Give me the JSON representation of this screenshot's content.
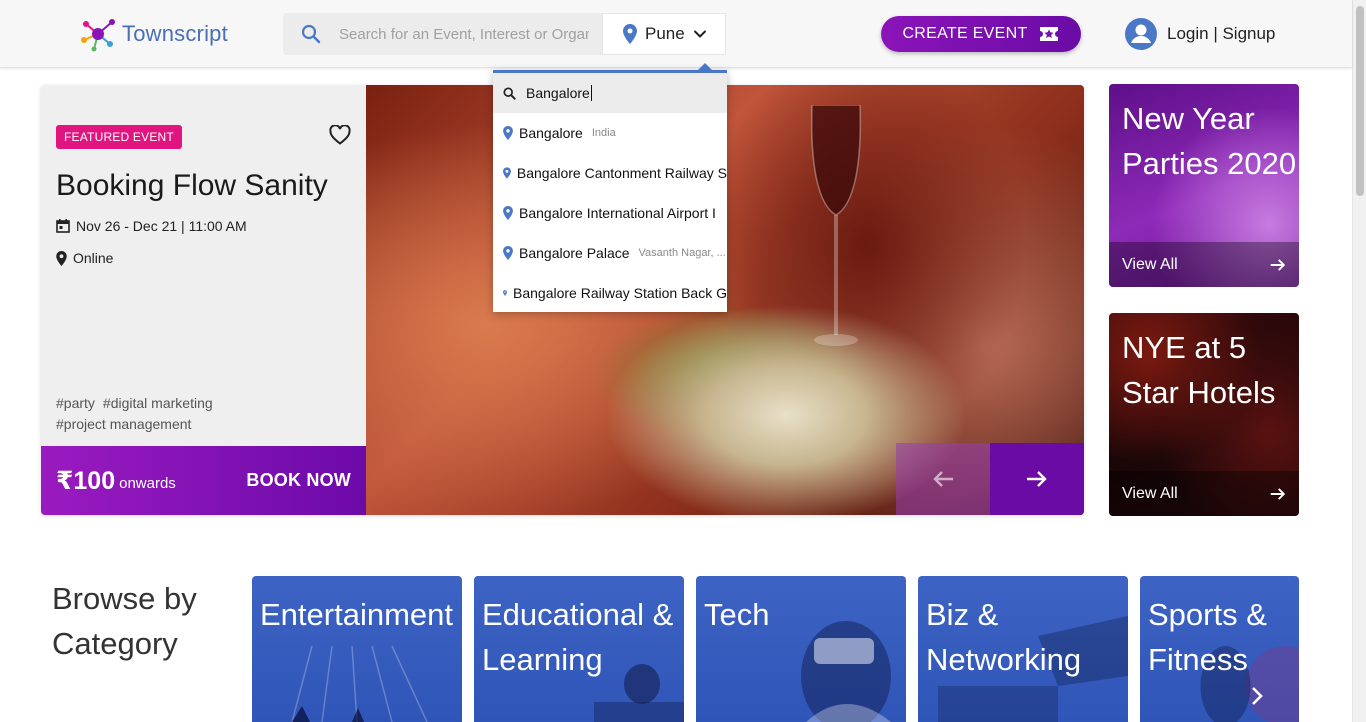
{
  "header": {
    "logo_text": "Townscript",
    "search_placeholder": "Search for an Event, Interest or Organizer",
    "city": "Pune",
    "create_event_label": "CREATE EVENT",
    "login_label": "Login | Signup"
  },
  "city_dropdown": {
    "query": "Bangalore",
    "items": [
      {
        "name": "Bangalore",
        "sub": "India"
      },
      {
        "name": "Bangalore Cantonment Railway S",
        "sub": ""
      },
      {
        "name": "Bangalore International Airport I",
        "sub": ""
      },
      {
        "name": "Bangalore Palace",
        "sub": "Vasanth Nagar, ..."
      },
      {
        "name": "Bangalore Railway Station Back G",
        "sub": ""
      }
    ]
  },
  "featured": {
    "badge": "FEATURED EVENT",
    "title": "Booking Flow Sanity",
    "date": "Nov 26 - Dec 21 | 11:00 AM",
    "location": "Online",
    "tags": [
      "#party",
      "#digital marketing",
      "#project management"
    ],
    "price": "₹100",
    "price_suffix": "onwards",
    "book_label": "BOOK NOW"
  },
  "promos": [
    {
      "title": "New Year Parties 2020",
      "link": "View All"
    },
    {
      "title": "NYE at 5 Star Hotels",
      "link": "View All"
    }
  ],
  "browse": {
    "title": "Browse by Category",
    "categories": [
      "Entertainment",
      "Educational & Learning",
      "Tech",
      "Biz & Networking",
      "Sports & Fitness"
    ]
  },
  "colors": {
    "brand_purple": "#6a0ba6",
    "badge_pink": "#e0157f",
    "accent_blue": "#4a78c6",
    "category_blue": "#3d63c4"
  }
}
